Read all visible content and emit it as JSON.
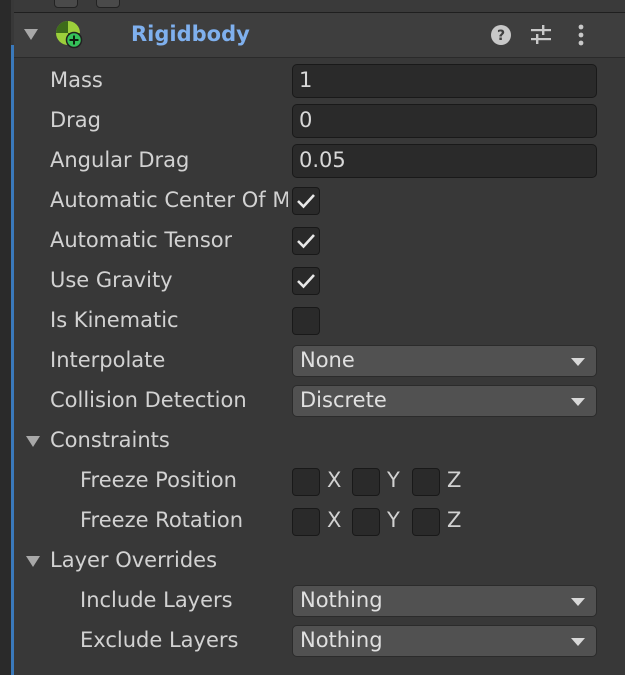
{
  "header": {
    "title": "Rigidbody",
    "help_icon": "help-icon",
    "preset_icon": "preset-sliders-icon",
    "menu_icon": "kebab-menu-icon"
  },
  "properties": {
    "mass": {
      "label": "Mass",
      "value": "1"
    },
    "drag": {
      "label": "Drag",
      "value": "0"
    },
    "angular_drag": {
      "label": "Angular Drag",
      "value": "0.05"
    },
    "auto_center_of_mass": {
      "label": "Automatic Center Of Mass",
      "checked": true
    },
    "auto_tensor": {
      "label": "Automatic Tensor",
      "checked": true
    },
    "use_gravity": {
      "label": "Use Gravity",
      "checked": true
    },
    "is_kinematic": {
      "label": "Is Kinematic",
      "checked": false
    },
    "interpolate": {
      "label": "Interpolate",
      "value": "None"
    },
    "collision_detection": {
      "label": "Collision Detection",
      "value": "Discrete"
    }
  },
  "constraints": {
    "label": "Constraints",
    "freeze_position": {
      "label": "Freeze Position",
      "x": "X",
      "y": "Y",
      "z": "Z"
    },
    "freeze_rotation": {
      "label": "Freeze Rotation",
      "x": "X",
      "y": "Y",
      "z": "Z"
    }
  },
  "layer_overrides": {
    "label": "Layer Overrides",
    "include_layers": {
      "label": "Include Layers",
      "value": "Nothing"
    },
    "exclude_layers": {
      "label": "Exclude Layers",
      "value": "Nothing"
    }
  },
  "colors": {
    "accent": "#3a79bb",
    "title": "#7fb0ee",
    "panel": "#383838"
  }
}
